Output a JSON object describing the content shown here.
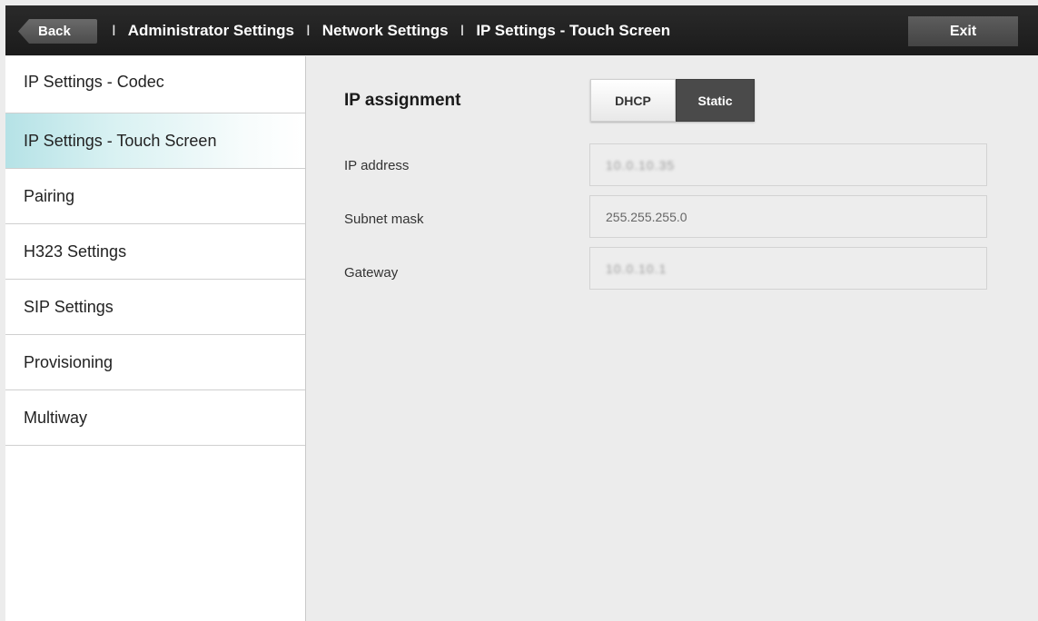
{
  "header": {
    "back_label": "Back",
    "separator": "I",
    "breadcrumbs": [
      "Administrator Settings",
      "Network Settings",
      "IP Settings - Touch Screen"
    ],
    "exit_label": "Exit"
  },
  "sidebar": {
    "items": [
      {
        "label": "IP Settings - Codec",
        "active": false
      },
      {
        "label": "IP Settings - Touch Screen",
        "active": true
      },
      {
        "label": "Pairing",
        "active": false
      },
      {
        "label": "H323 Settings",
        "active": false
      },
      {
        "label": "SIP Settings",
        "active": false
      },
      {
        "label": "Provisioning",
        "active": false
      },
      {
        "label": "Multiway",
        "active": false
      }
    ]
  },
  "main": {
    "ip_assignment_label": "IP assignment",
    "ip_assignment_options": [
      "DHCP",
      "Static"
    ],
    "ip_assignment_selected": "Static",
    "fields": {
      "ip_address": {
        "label": "IP address",
        "value": "10.0.10.35"
      },
      "subnet_mask": {
        "label": "Subnet mask",
        "value": "255.255.255.0"
      },
      "gateway": {
        "label": "Gateway",
        "value": "10.0.10.1"
      }
    }
  },
  "colors": {
    "topbar": "#1f1f1f",
    "active_item": "#b5e2e6",
    "static_selected": "#4a4a4a"
  }
}
